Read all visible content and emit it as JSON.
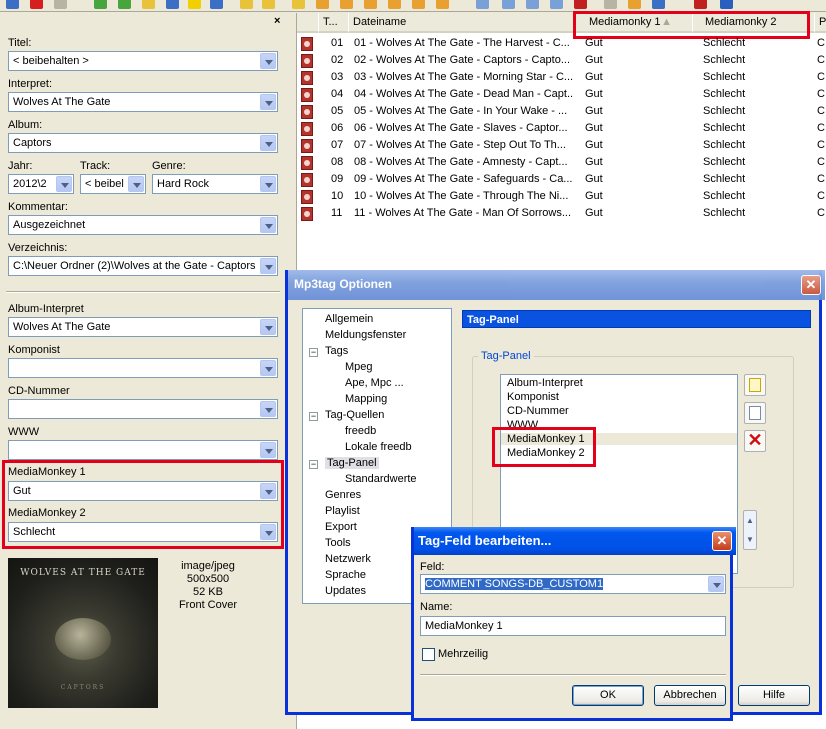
{
  "left": {
    "fields": [
      {
        "label": "Titel:",
        "value": "< beibehalten >"
      },
      {
        "label": "Interpret:",
        "value": "Wolves At The Gate"
      },
      {
        "label": "Album:",
        "value": "Captors"
      },
      {
        "label": "Jahr:",
        "value": "2012\\2"
      },
      {
        "label": "Track:",
        "value": "< beibel"
      },
      {
        "label": "Genre:",
        "value": "Hard Rock"
      },
      {
        "label": "Kommentar:",
        "value": "Ausgezeichnet"
      },
      {
        "label": "Verzeichnis:",
        "value": "C:\\Neuer Ordner (2)\\Wolves at the Gate - Captors"
      },
      {
        "label": "Album-Interpret",
        "value": "Wolves At The Gate"
      },
      {
        "label": "Komponist",
        "value": ""
      },
      {
        "label": "CD-Nummer",
        "value": ""
      },
      {
        "label": "WWW",
        "value": ""
      },
      {
        "label": "MediaMonkey 1",
        "value": "Gut"
      },
      {
        "label": "MediaMonkey 2",
        "value": "Schlecht"
      }
    ],
    "cover": {
      "band": "WOLVES AT THE GATE",
      "album": "CAPTORS",
      "mime": "image/jpeg",
      "dims": "500x500",
      "size": "52 KB",
      "type": "Front Cover"
    }
  },
  "list": {
    "columns": [
      "T...",
      "Dateiname",
      "Mediamonky 1",
      "Mediamonky 2",
      "Pf"
    ],
    "rows": [
      {
        "t": "01",
        "file": "01 - Wolves At The Gate - The Harvest - C...",
        "m1": "Gut",
        "m2": "Schlecht",
        "p": "C:"
      },
      {
        "t": "02",
        "file": "02 - Wolves At The Gate - Captors - Capto...",
        "m1": "Gut",
        "m2": "Schlecht",
        "p": "C:"
      },
      {
        "t": "03",
        "file": "03 - Wolves At The Gate - Morning Star - C...",
        "m1": "Gut",
        "m2": "Schlecht",
        "p": "C:"
      },
      {
        "t": "04",
        "file": "04 - Wolves At The Gate - Dead Man - Capt...",
        "m1": "Gut",
        "m2": "Schlecht",
        "p": "C:"
      },
      {
        "t": "05",
        "file": "05 - Wolves At The Gate - In Your Wake - ...",
        "m1": "Gut",
        "m2": "Schlecht",
        "p": "C:"
      },
      {
        "t": "06",
        "file": "06 - Wolves At The Gate - Slaves - Captor...",
        "m1": "Gut",
        "m2": "Schlecht",
        "p": "C:"
      },
      {
        "t": "07",
        "file": "07 - Wolves At The Gate - Step Out To Th...",
        "m1": "Gut",
        "m2": "Schlecht",
        "p": "C:"
      },
      {
        "t": "08",
        "file": "08 - Wolves At The Gate - Amnesty - Capt...",
        "m1": "Gut",
        "m2": "Schlecht",
        "p": "C:"
      },
      {
        "t": "09",
        "file": "09 - Wolves At The Gate - Safeguards - Ca...",
        "m1": "Gut",
        "m2": "Schlecht",
        "p": "C:"
      },
      {
        "t": "10",
        "file": "10 - Wolves At The Gate - Through The Ni...",
        "m1": "Gut",
        "m2": "Schlecht",
        "p": "C:"
      },
      {
        "t": "11",
        "file": "11 - Wolves At The Gate - Man Of Sorrows...",
        "m1": "Gut",
        "m2": "Schlecht",
        "p": "C:"
      }
    ]
  },
  "options": {
    "title": "Mp3tag Optionen",
    "close": "✕",
    "tree": [
      "Allgemein",
      "Meldungsfenster",
      "Tags",
      "Mpeg",
      "Ape, Mpc ...",
      "Mapping",
      "Tag-Quellen",
      "freedb",
      "Lokale freedb",
      "Tag-Panel",
      "Standardwerte",
      "Genres",
      "Playlist",
      "Export",
      "Tools",
      "Netzwerk",
      "Sprache",
      "Updates"
    ],
    "panel_header": "Tag-Panel",
    "group_label": "Tag-Panel",
    "items": [
      "Album-Interpret",
      "Komponist",
      "CD-Nummer",
      "WWW",
      "MediaMonkey 1",
      "MediaMonkey 2"
    ],
    "help": "Hilfe"
  },
  "edit": {
    "title": "Tag-Feld bearbeiten...",
    "close": "✕",
    "feld_label": "Feld:",
    "feld_value": "COMMENT SONGS-DB_CUSTOM1",
    "name_label": "Name:",
    "name_value": "MediaMonkey 1",
    "multiline": "Mehrzeilig",
    "ok": "OK",
    "cancel": "Abbrechen"
  },
  "colors": {
    "highlight": "#e3001b",
    "selection": "#316ac5"
  }
}
